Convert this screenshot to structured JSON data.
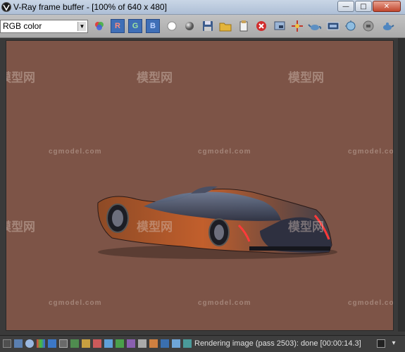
{
  "window": {
    "title": "V-Ray frame buffer - [100% of 640 x 480]",
    "minimize_glyph": "—",
    "maximize_glyph": "□",
    "close_glyph": "✕"
  },
  "toolbar": {
    "channel_select": "RGB color",
    "channel_select_arrow": "▼",
    "red_label": "R",
    "green_label": "G",
    "blue_label": "B"
  },
  "watermarks": {
    "brand": "cgmodel.com",
    "chinese": "模型网"
  },
  "status": {
    "text": "Rendering image (pass 2503): done [00:00:14.3]"
  },
  "colors": {
    "viewport_bg": "#7d5447",
    "car_body": "#b9572a",
    "car_glass": "#4a5a7a",
    "tail_light": "#ff3a3a",
    "channel_button": "#3f6fb7"
  }
}
